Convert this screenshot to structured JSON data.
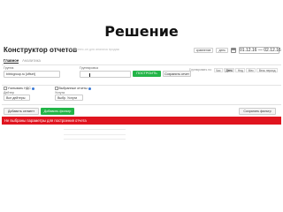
{
  "slide": {
    "title": "Решение"
  },
  "header": {
    "title": "Конструктор отчетов",
    "subtitle": "Это бизнес-оп для анализа продаж",
    "compare_select": "сравнение",
    "period_select": "день",
    "date_range": "01.12.16 — 02.12.16"
  },
  "tabs": [
    {
      "label": "Главное"
    },
    {
      "label": "Аналитика"
    }
  ],
  "group_section": {
    "label": "Группа",
    "value": "bitrixgroup.ru [offset]"
  },
  "grouping_section": {
    "label": "Группировка",
    "value": ""
  },
  "buttons": {
    "build": "ПОСТРОИТЬ",
    "save_report": "Сохранить отчет",
    "add_segment": "Добавить сегмент",
    "add_filter": "Добавить фильтр",
    "save_widget": "Сохранить фильтр"
  },
  "segmented": {
    "label": "Группировать по:",
    "options": [
      {
        "label": "Час",
        "active": false
      },
      {
        "label": "День",
        "active": true
      },
      {
        "label": "Нед",
        "active": false
      },
      {
        "label": "Мес",
        "active": false
      },
      {
        "label": "Весь период",
        "active": false
      }
    ]
  },
  "checkboxes": [
    {
      "label": "Учитывать НДС",
      "dot": true
    },
    {
      "label": "Выбранные отчеты",
      "dot": true
    }
  ],
  "filters": {
    "left_label": "Дейтер",
    "left_value": "Все дейтеры",
    "right_label": "Услуга",
    "right_value": "Выбр. Услуги"
  },
  "error": {
    "message": "Не выбраны параметры для построения отчета"
  },
  "colors": {
    "accent_green": "#23b548",
    "error_red": "#e0141f",
    "link_blue": "#3c7bd6"
  }
}
